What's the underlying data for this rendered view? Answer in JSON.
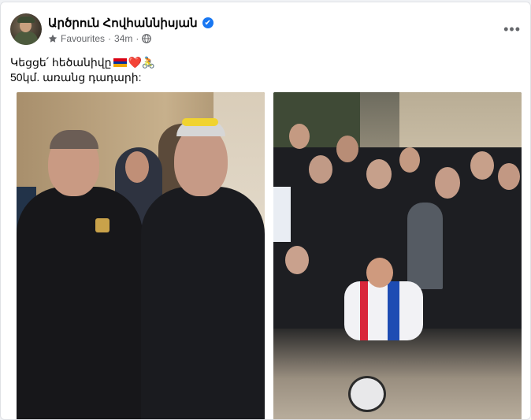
{
  "post": {
    "author_name": "Արծրուն Հովհաննիսյան",
    "audience": "Favourites",
    "separator": "·",
    "time": "34m",
    "more": "•••",
    "verified_mark": "✔",
    "text_line1_before": "Կեցցե՛ հեծանիվը",
    "text_line1_after": "❤️🚴",
    "text_line2": "50կմ. առանց դադարի:"
  },
  "icons": {
    "verified": "verified-badge-icon",
    "audience": "star-icon",
    "privacy": "globe-icon",
    "more": "more-options-icon"
  },
  "colors": {
    "accent": "#1877f2",
    "text_primary": "#050505",
    "text_secondary": "#65676b",
    "flag": [
      "#d90012",
      "#0033a0",
      "#f2a800"
    ]
  }
}
